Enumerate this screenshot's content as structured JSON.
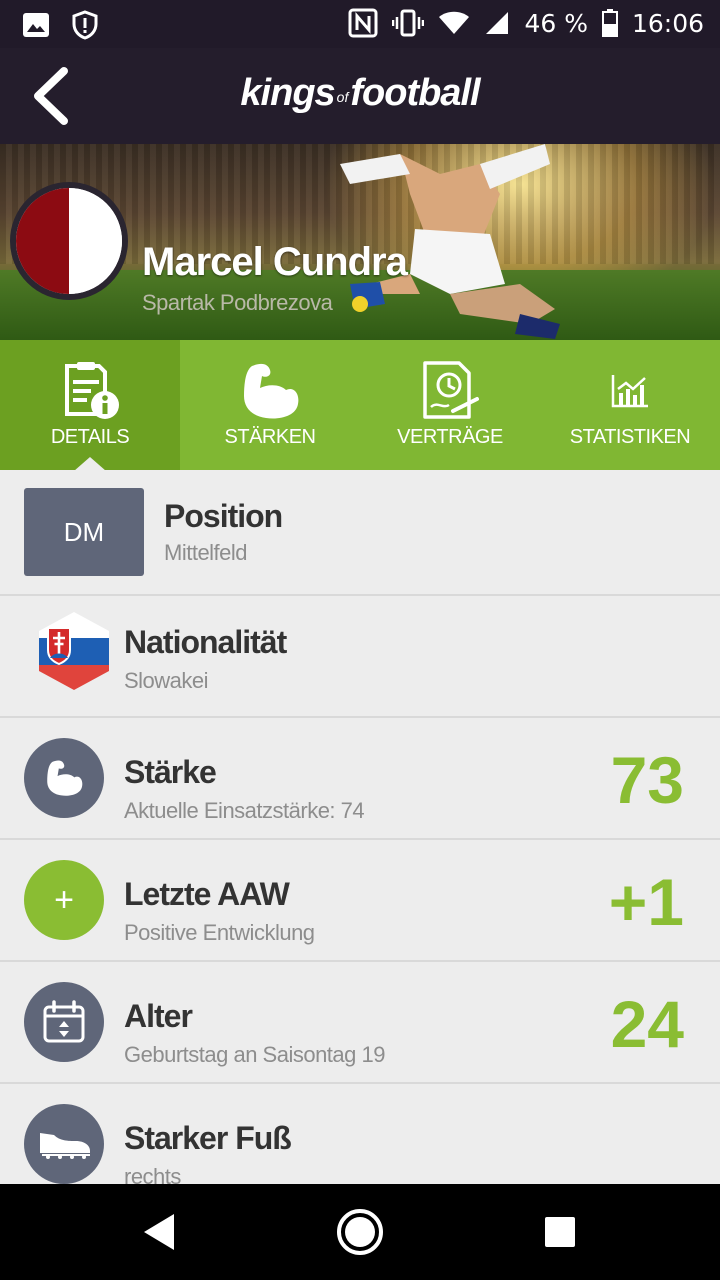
{
  "status_bar": {
    "battery_percent": "46 %",
    "time": "16:06"
  },
  "app_bar": {
    "logo_part1": "kings",
    "logo_of": "of",
    "logo_part2": "football"
  },
  "player": {
    "name": "Marcel Cundra",
    "club": "Spartak Podbrezova",
    "club_colors": [
      "#8c0b12",
      "#ffffff"
    ]
  },
  "tabs": [
    {
      "label": "DETAILS",
      "icon": "details-icon",
      "active": true
    },
    {
      "label": "STÄRKEN",
      "icon": "strength-icon",
      "active": false
    },
    {
      "label": "VERTRÄGE",
      "icon": "contract-icon",
      "active": false
    },
    {
      "label": "STATISTIKEN",
      "icon": "statistics-icon",
      "active": false
    }
  ],
  "details": {
    "position": {
      "badge": "DM",
      "title": "Position",
      "subtitle": "Mittelfeld"
    },
    "nationality": {
      "title": "Nationalität",
      "subtitle": "Slowakei",
      "icon": "slovakia-flag-icon"
    },
    "strength": {
      "title": "Stärke",
      "subtitle": "Aktuelle Einsatzstärke: 74",
      "value": "73",
      "icon": "bicep-icon"
    },
    "last_aaw": {
      "title": "Letzte AAW",
      "subtitle": "Positive Entwicklung",
      "value": "+1",
      "icon": "+"
    },
    "age": {
      "title": "Alter",
      "subtitle": "Geburtstag an Saisontag 19",
      "value": "24",
      "icon": "calendar-icon"
    },
    "foot": {
      "title": "Starker Fuß",
      "subtitle": "rechts",
      "icon": "boot-icon"
    }
  },
  "colors": {
    "accent_green": "#8abd33",
    "tab_green": "#80b733",
    "tab_active": "#6ca021",
    "icon_circle": "#5f6679",
    "app_bar": "#241d2c"
  }
}
